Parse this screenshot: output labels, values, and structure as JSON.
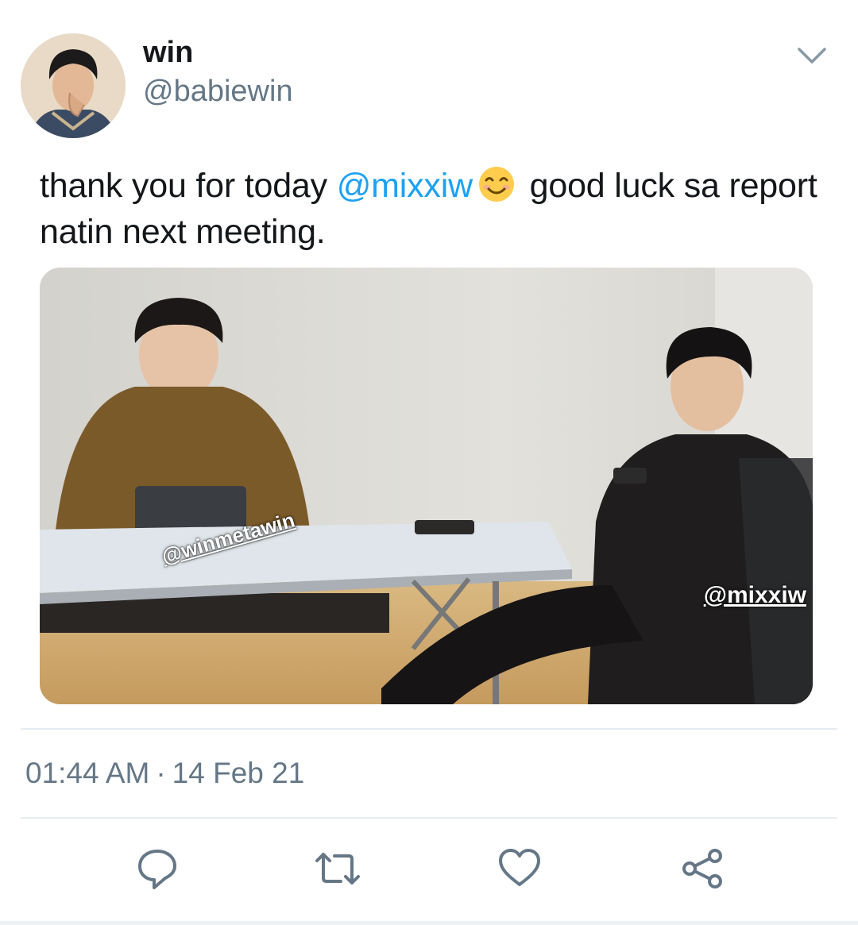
{
  "tweet": {
    "author": {
      "display_name": "win",
      "handle": "@babiewin"
    },
    "text": {
      "part1": "thank you for today ",
      "mention": "@mixxiw",
      "emoji_icon": "smiling-face-icon",
      "part2": " good luck sa report natin next meeting."
    },
    "media": {
      "watermark_left": "@winmetawin",
      "watermark_right": "@mixxiw"
    },
    "time": "01:44 AM",
    "separator": "·",
    "date": "14 Feb 21"
  },
  "actions": [
    {
      "icon": "reply-icon"
    },
    {
      "icon": "retweet-icon"
    },
    {
      "icon": "like-icon"
    },
    {
      "icon": "share-icon"
    }
  ],
  "colors": {
    "accent": "#1da1f2",
    "secondary_text": "#657786",
    "divider": "#e6ecf0"
  }
}
